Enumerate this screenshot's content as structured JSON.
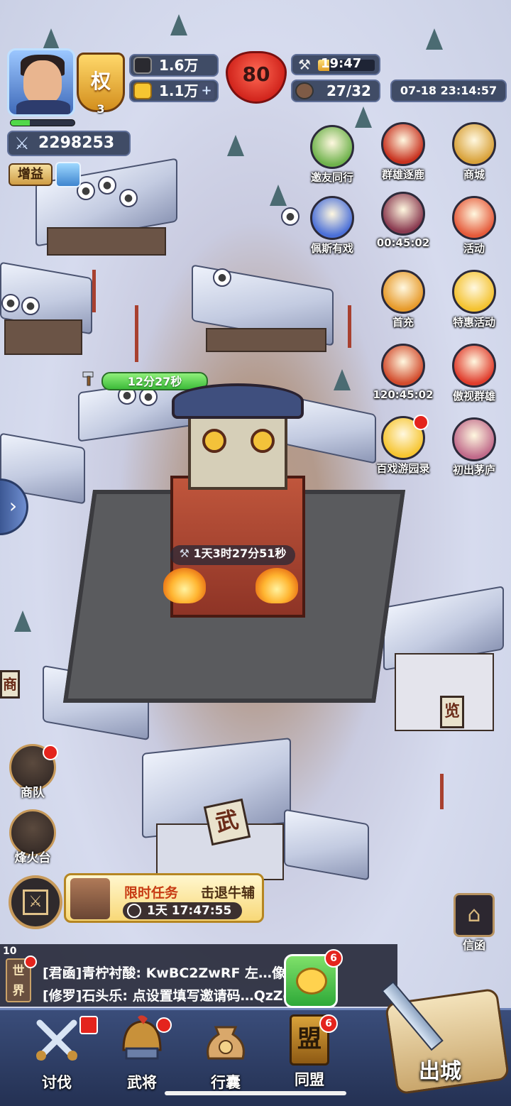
{
  "hud": {
    "rank_glyph": "权",
    "rank_level": "3",
    "exp_fraction": 0.3,
    "copper": "1.6万",
    "gold": "1.1万",
    "stamina": "80",
    "build_timer": "19:47",
    "build_progress_fraction": 0.2,
    "troops": "27/32",
    "datetime": "07-18 23:14:57",
    "power": "2298253",
    "buff_label": "增益"
  },
  "activities": [
    {
      "label": "邀友同行",
      "icon": "friend-icon",
      "color": "#6fb24c"
    },
    {
      "label": "群雄逐鹿",
      "icon": "banner-icon",
      "color": "#c8321f"
    },
    {
      "label": "商城",
      "icon": "shop-icon",
      "color": "#d9a23a"
    },
    {
      "label": "佩斯有戏",
      "icon": "elder-portrait-icon",
      "color": "#4a6fd8"
    },
    {
      "label": "00:45:02",
      "icon": "heroine-portrait-icon",
      "color": "#8a3a50"
    },
    {
      "label": "活动",
      "icon": "drum-icon",
      "color": "#e55a3a"
    },
    {
      "label": "首充",
      "icon": "hero-portrait-icon",
      "color": "#e79a2a"
    },
    {
      "label": "特惠活动",
      "icon": "gold-ingot-icon",
      "color": "#f4c22f"
    },
    {
      "label": "120:45:02",
      "icon": "opera-mask-icon",
      "color": "#d24b2c"
    },
    {
      "label": "傲视群雄",
      "icon": "sword-flag-icon",
      "color": "#e03c2c"
    },
    {
      "label": "百戏游园录",
      "icon": "number-two-icon",
      "color": "#f6c531"
    },
    {
      "label": "初出茅庐",
      "icon": "maiden-portrait-icon",
      "color": "#c06a8a"
    }
  ],
  "map": {
    "construction_timer": "12分27秒",
    "main_building_timer": "1天3时27分51秒",
    "sign_shop": "商",
    "sign_martial": "武",
    "sign_side": "览"
  },
  "side_buttons": [
    {
      "label": "商队",
      "icon": "caravan-icon"
    },
    {
      "label": "烽火台",
      "icon": "beacon-tower-icon"
    }
  ],
  "quest": {
    "title": "限时任务",
    "target": "击退牛辅",
    "timer": "1天 17:47:55",
    "ring_glyph": "⚔"
  },
  "mail": {
    "label": "信函",
    "glyph": "⌂"
  },
  "chat": {
    "count": "10",
    "channel": "世界",
    "line1": "[君凾]青柠衬酸: KwBC2ZwRF 左…像，…",
    "line2": "[修罗]石头乐: 点设置填写邀请码…QzZe …",
    "alliance_badge": "6"
  },
  "nav": [
    {
      "label": "讨伐",
      "icon": "crossed-swords-icon"
    },
    {
      "label": "武将",
      "icon": "helmet-icon"
    },
    {
      "label": "行囊",
      "icon": "bag-icon"
    },
    {
      "label": "同盟",
      "icon": "alliance-banner-icon",
      "badge": "6",
      "glyph": "盟"
    }
  ],
  "depart_label": "出城"
}
